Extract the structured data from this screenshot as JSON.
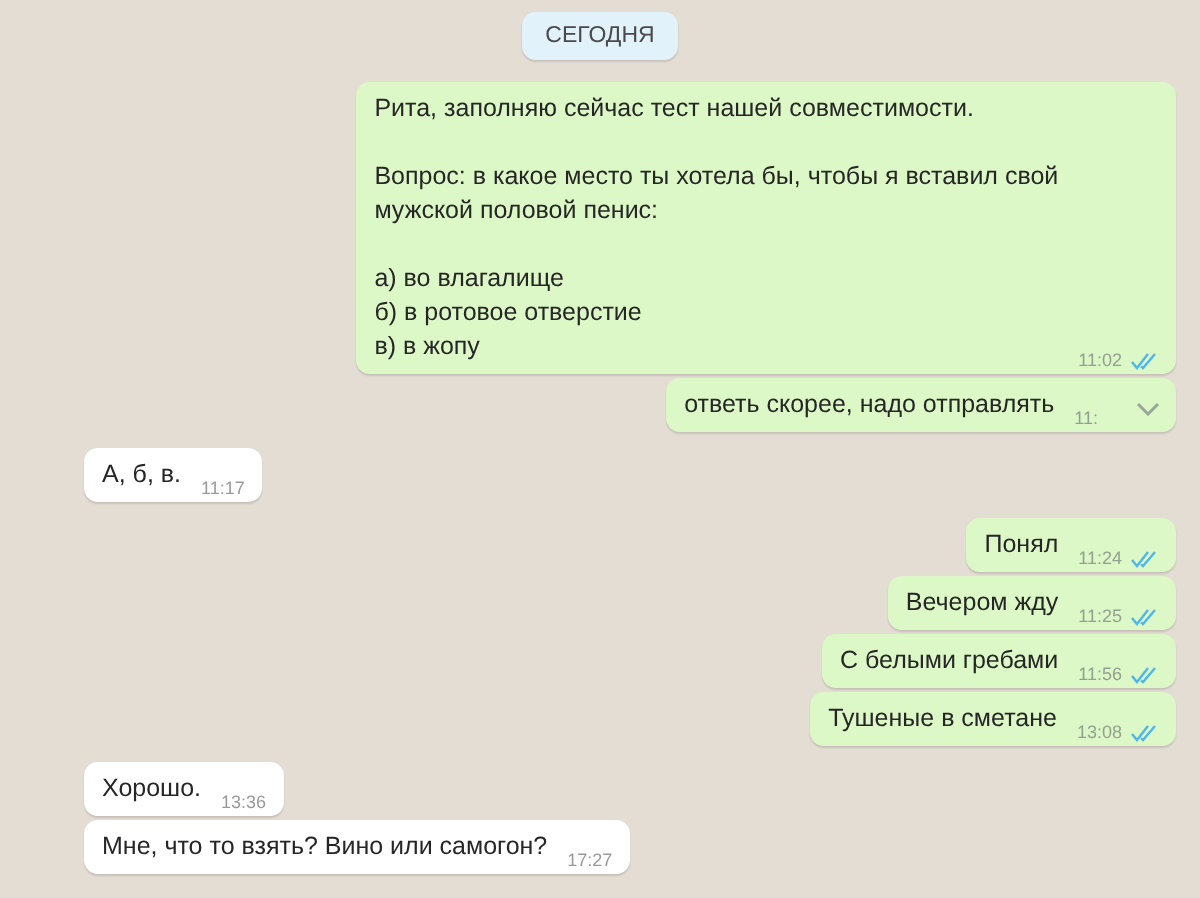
{
  "date_chip": "СЕГОДНЯ",
  "messages": [
    {
      "outgoing": true,
      "paragraphs": [
        "Рита, заполняю сейчас тест нашей совместимости.",
        "Вопрос: в какое место ты хотела бы, чтобы я вставил свой\nмужской половой пенис:",
        "а) во влагалище\nб) в ротовое отверстие\nв) в жопу"
      ],
      "time": "11:02",
      "read": true,
      "hovered": false
    },
    {
      "outgoing": true,
      "paragraphs": [
        "ответь скорее, надо отправлять"
      ],
      "time": "11:",
      "read": false,
      "hovered": true
    },
    {
      "outgoing": false,
      "paragraphs": [
        "А, б, в."
      ],
      "time": "11:17"
    },
    {
      "outgoing": true,
      "paragraphs": [
        "Понял"
      ],
      "time": "11:24",
      "read": true,
      "hovered": false
    },
    {
      "outgoing": true,
      "paragraphs": [
        "Вечером жду"
      ],
      "time": "11:25",
      "read": true,
      "hovered": false
    },
    {
      "outgoing": true,
      "paragraphs": [
        "С белыми гребами"
      ],
      "time": "11:56",
      "read": true,
      "hovered": false
    },
    {
      "outgoing": true,
      "paragraphs": [
        "Тушеные в сметане"
      ],
      "time": "13:08",
      "read": true,
      "hovered": false
    },
    {
      "outgoing": false,
      "paragraphs": [
        "Хорошо."
      ],
      "time": "13:36"
    },
    {
      "outgoing": false,
      "paragraphs": [
        "Мне, что то взять? Вино или самогон?"
      ],
      "time": "17:27"
    }
  ]
}
